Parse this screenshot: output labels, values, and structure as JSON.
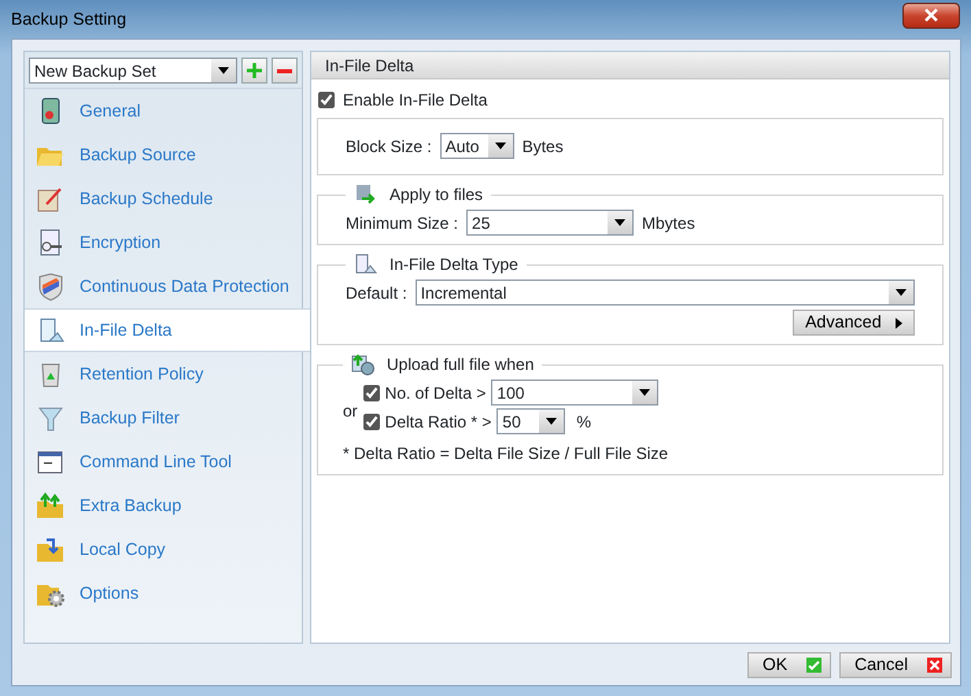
{
  "window": {
    "title": "Backup Setting"
  },
  "backup_set": {
    "value": "New Backup Set"
  },
  "sidebar": {
    "items": [
      {
        "label": "General",
        "selected": false
      },
      {
        "label": "Backup Source",
        "selected": false
      },
      {
        "label": "Backup Schedule",
        "selected": false
      },
      {
        "label": "Encryption",
        "selected": false
      },
      {
        "label": "Continuous Data Protection",
        "selected": false
      },
      {
        "label": "In-File Delta",
        "selected": true
      },
      {
        "label": "Retention Policy",
        "selected": false
      },
      {
        "label": "Backup Filter",
        "selected": false
      },
      {
        "label": "Command Line Tool",
        "selected": false
      },
      {
        "label": "Extra Backup",
        "selected": false
      },
      {
        "label": "Local Copy",
        "selected": false
      },
      {
        "label": "Options",
        "selected": false
      }
    ]
  },
  "panel": {
    "title": "In-File Delta",
    "enable": {
      "label": "Enable In-File Delta",
      "checked": true
    },
    "block_size": {
      "label": "Block Size :",
      "value": "Auto",
      "unit": "Bytes"
    },
    "apply": {
      "title": "Apply to files",
      "label": "Minimum Size :",
      "value": "25",
      "unit": "Mbytes"
    },
    "type": {
      "title": "In-File Delta Type",
      "label": "Default :",
      "value": "Incremental",
      "button": "Advanced"
    },
    "upload": {
      "title": "Upload full file when",
      "or": "or",
      "conditions": [
        {
          "label": "No. of Delta >",
          "checked": true,
          "value": "100"
        },
        {
          "label": "Delta Ratio * >",
          "checked": true,
          "value": "50",
          "unit": "%"
        }
      ],
      "note": "* Delta Ratio = Delta File Size / Full File Size"
    }
  },
  "buttons": [
    {
      "label": "OK",
      "kind": "ok"
    },
    {
      "label": "Cancel",
      "kind": "cancel"
    }
  ]
}
